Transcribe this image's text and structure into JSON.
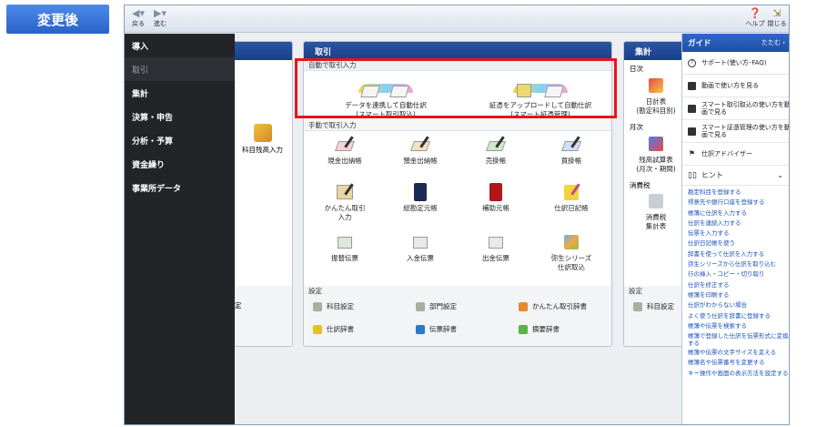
{
  "badge": "変更後",
  "toolbar": {
    "back": "戻る",
    "forward": "進む",
    "help": "ヘルプ",
    "close": "閉じる"
  },
  "menu": [
    "導入",
    "取引",
    "集計",
    "決算・申告",
    "分析・予算",
    "資金繰り",
    "事業所データ"
  ],
  "left_panel": {
    "item": "科目残高入力",
    "setting_partial": "定"
  },
  "torihiki": {
    "title": "取引",
    "auto_section": "自動で取引入力",
    "auto_items": [
      {
        "line1": "データを連携して自動仕訳",
        "line2": "(スマート取引取込)"
      },
      {
        "line1": "証憑をアップロードして自動仕訳",
        "line2": "(スマート証憑管理)"
      }
    ],
    "manual_section": "手動で取引入力",
    "manual_items": [
      {
        "label": "現金出納帳",
        "label2": ""
      },
      {
        "label": "預金出納帳",
        "label2": ""
      },
      {
        "label": "売掛帳",
        "label2": ""
      },
      {
        "label": "買掛帳",
        "label2": ""
      },
      {
        "label": "かんたん取引",
        "label2": "入力"
      },
      {
        "label": "総勘定元帳",
        "label2": ""
      },
      {
        "label": "補助元帳",
        "label2": ""
      },
      {
        "label": "仕訳日記帳",
        "label2": ""
      },
      {
        "label": "振替伝票",
        "label2": ""
      },
      {
        "label": "入金伝票",
        "label2": ""
      },
      {
        "label": "出金伝票",
        "label2": ""
      },
      {
        "label": "弥生シリーズ",
        "label2": "仕訳取込"
      }
    ],
    "settings_section": "設定",
    "settings": [
      "科目設定",
      "部門設定",
      "かんたん取引辞書",
      "仕訳辞書",
      "伝票辞書",
      "摘要辞書"
    ]
  },
  "shukei": {
    "title": "集計",
    "daily": "日次",
    "daily_item": {
      "line1": "日計表",
      "line2": "(勘定科目別)"
    },
    "monthly": "月次",
    "monthly_item": {
      "line1": "残高試算表",
      "line2": "(月次・期間)"
    },
    "tax": "消費税",
    "tax_item": {
      "line1": "消費税",
      "line2": "集計表"
    },
    "settings_section": "設定",
    "setting_item": "科目設定"
  },
  "guide": {
    "title": "ガイド",
    "collapse": "たたむ",
    "rows": [
      "サポート(使い方･FAQ)",
      "動画で使い方を見る",
      "スマート取引取込の使い方を動画で見る",
      "スマート証憑管理の使い方を動画で見る",
      "仕訳アドバイザー"
    ],
    "hint_title": "ヒント",
    "hints": [
      "勘定科目を登録する",
      "得意先や銀行口座を登録する",
      "帳簿に仕訳を入力する",
      "仕訳を連続入力する",
      "伝票を入力する",
      "仕訳日記帳を使う",
      "辞書を使って仕訳を入力する",
      "弥生シリーズから仕訳を取り込む",
      "行の挿入・コピー・切り取り",
      "仕訳を修正する",
      "帳簿を印刷する",
      "仕訳がわからない場合",
      "よく使う仕訳を辞書に登録する",
      "帳簿や伝票を検索する",
      "帳簿で登録した仕訳を伝票形式に変換する",
      "帳簿や伝票の文字サイズを変える",
      "帳簿名や伝票番号を変更する",
      "キー操作や画面の表示方法を設定する"
    ]
  },
  "colors": {
    "accent": "#1e4fa8",
    "menu_bg": "#222428",
    "highlight": "#e8141b",
    "link": "#1a52b5"
  }
}
